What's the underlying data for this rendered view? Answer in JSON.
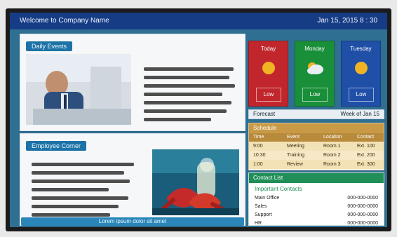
{
  "header": {
    "title": "Welcome to Company Name",
    "datetime": "Jan 15, 2015   8 : 30"
  },
  "sections": {
    "top_left": {
      "tab_label": "Daily Events",
      "text_lines": 7
    },
    "bottom_left": {
      "tab_label": "Employee Corner",
      "text_lines": 8,
      "bottom_strip": "Lorem ipsum dolor sit amet"
    }
  },
  "weather": {
    "cards": [
      {
        "day": "Today",
        "low": "Low",
        "color": "#c1262c",
        "icon": "sun-icon"
      },
      {
        "day": "Monday",
        "low": "Low",
        "color": "#1a8f3a",
        "icon": "cloud-sun-icon"
      },
      {
        "day": "Tuesday",
        "low": "Low",
        "color": "#1f4fa6",
        "icon": "sun-icon"
      }
    ],
    "caption_left": "Forecast",
    "caption_right": "Week of Jan 15"
  },
  "schedule": {
    "title": "Schedule",
    "headers": [
      "Time",
      "Event",
      "Location",
      "Contact"
    ],
    "rows": [
      [
        "9:00",
        "Meeting",
        "Room 1",
        "Ext. 100"
      ],
      [
        "10:30",
        "Training",
        "Room 2",
        "Ext. 200"
      ],
      [
        "1:00",
        "Review",
        "Room 3",
        "Ext. 300"
      ]
    ]
  },
  "contacts": {
    "title": "Contact List",
    "subtitle": "Important Contacts",
    "rows": [
      [
        "Main Office",
        "000-000-0000"
      ],
      [
        "Sales",
        "000-000-0000"
      ],
      [
        "Support",
        "000-000-0000"
      ],
      [
        "HR",
        "000-000-0000"
      ]
    ]
  }
}
